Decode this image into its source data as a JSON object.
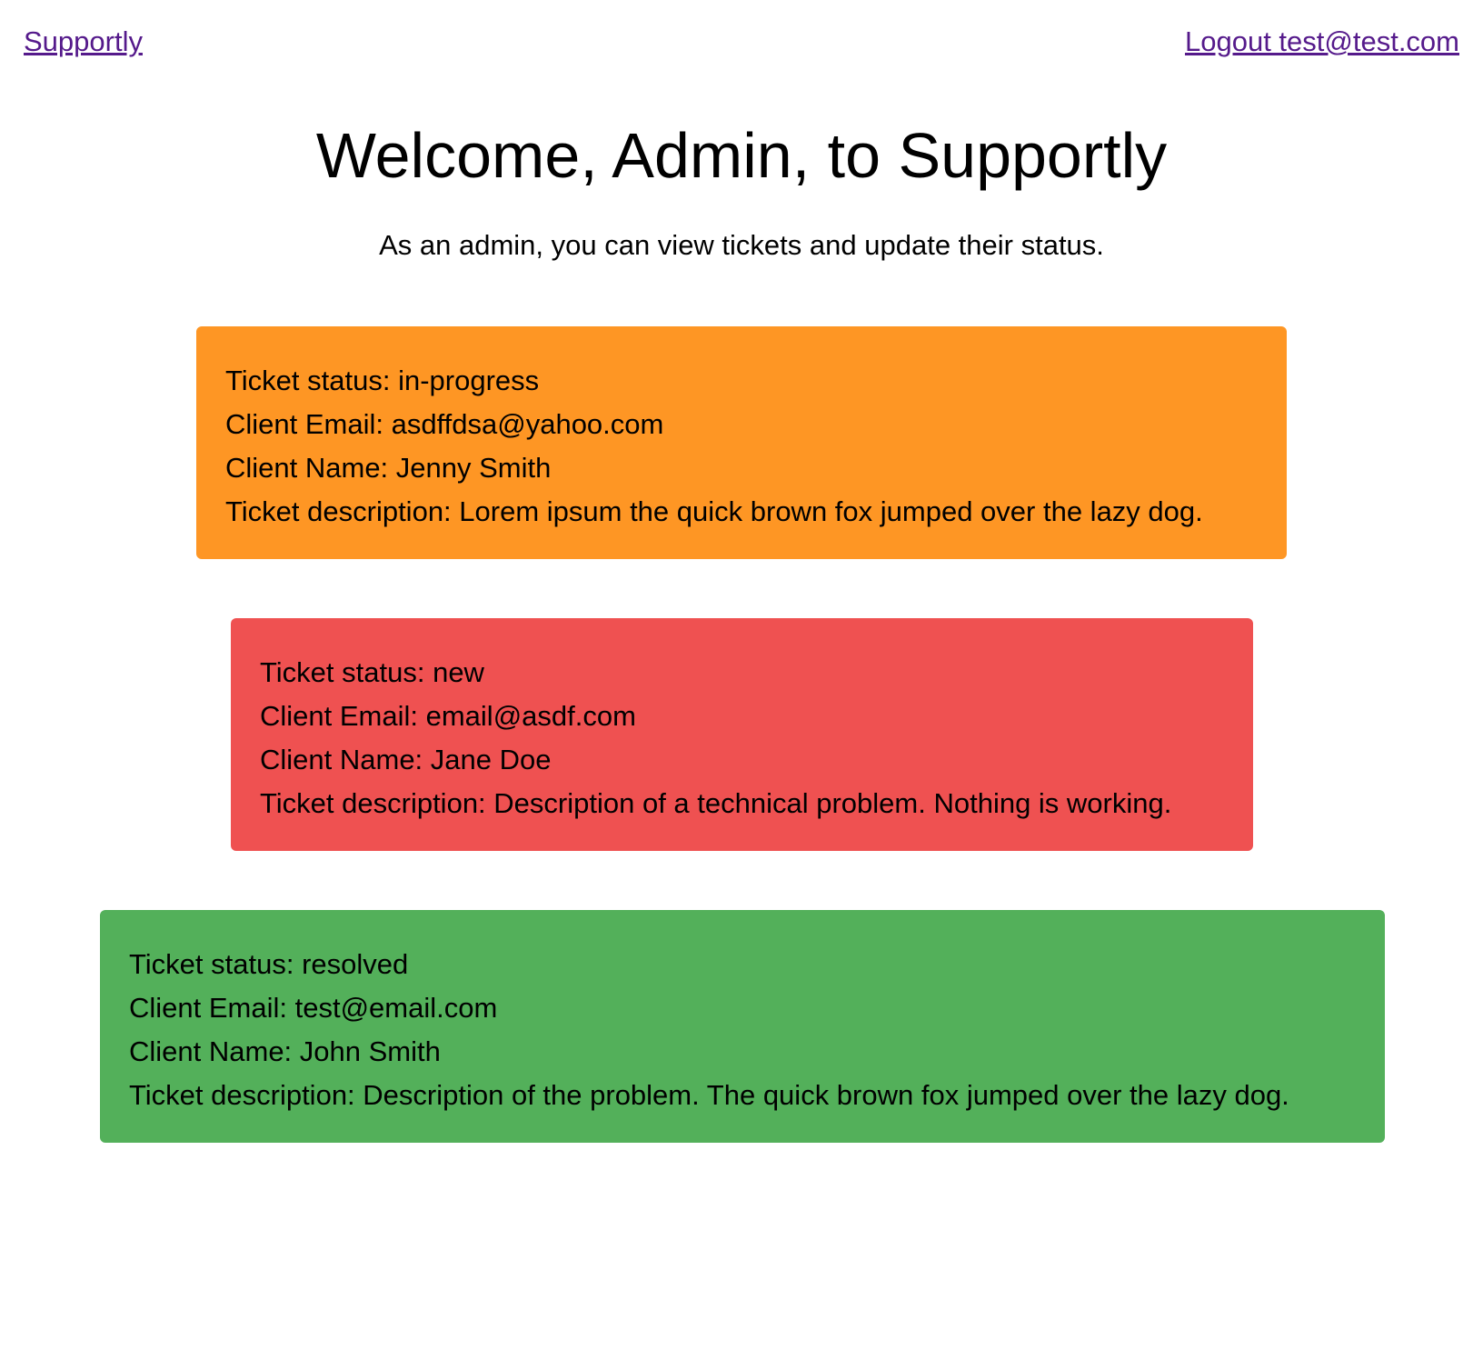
{
  "nav": {
    "brand": "Supportly",
    "logout": "Logout test@test.com"
  },
  "header": {
    "title": "Welcome, Admin, to Supportly",
    "subtitle": "As an admin, you can view tickets and update their status."
  },
  "labels": {
    "status": "Ticket status: ",
    "email": "Client Email: ",
    "name": "Client Name: ",
    "description": "Ticket description: "
  },
  "tickets": [
    {
      "status": "in-progress",
      "email": "asdffdsa@yahoo.com",
      "name": "Jenny Smith",
      "description": "Lorem ipsum the quick brown fox jumped over the lazy dog.",
      "color": "#fe9624"
    },
    {
      "status": "new",
      "email": "email@asdf.com",
      "name": "Jane Doe",
      "description": "Description of a technical problem. Nothing is working.",
      "color": "#ef5151"
    },
    {
      "status": "resolved",
      "email": "test@email.com",
      "name": "John Smith",
      "description": "Description of the problem. The quick brown fox jumped over the lazy dog.",
      "color": "#53b05a"
    }
  ]
}
